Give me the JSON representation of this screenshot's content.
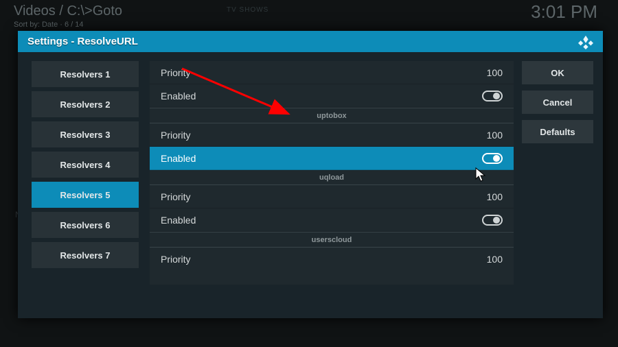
{
  "bg": {
    "title": "Videos / C:\\>Goto",
    "sort": "Sort by: Date · 6 / 14",
    "tv": "TV SHOWS",
    "clock": "3:01 PM",
    "left_char": "N"
  },
  "window": {
    "title": "Settings - ResolveURL"
  },
  "nav": {
    "r1": "Resolvers 1",
    "r2": "Resolvers 2",
    "r3": "Resolvers 3",
    "r4": "Resolvers 4",
    "r5": "Resolvers 5",
    "r6": "Resolvers 6",
    "r7": "Resolvers 7"
  },
  "groups": {
    "g0_priority_label": "Priority",
    "g0_priority_value": "100",
    "g0_enabled_label": "Enabled",
    "g0_enabled_state": "on",
    "g1_name": "uptobox",
    "g1_priority_label": "Priority",
    "g1_priority_value": "100",
    "g1_enabled_label": "Enabled",
    "g1_enabled_state": "on",
    "g2_name": "uqload",
    "g2_priority_label": "Priority",
    "g2_priority_value": "100",
    "g2_enabled_label": "Enabled",
    "g2_enabled_state": "on",
    "g3_name": "userscloud",
    "g3_priority_label": "Priority",
    "g3_priority_value": "100"
  },
  "buttons": {
    "ok": "OK",
    "cancel": "Cancel",
    "defaults": "Defaults"
  },
  "colors": {
    "accent": "#0d8cb8",
    "panel": "#19242a",
    "row": "#1f292e"
  }
}
